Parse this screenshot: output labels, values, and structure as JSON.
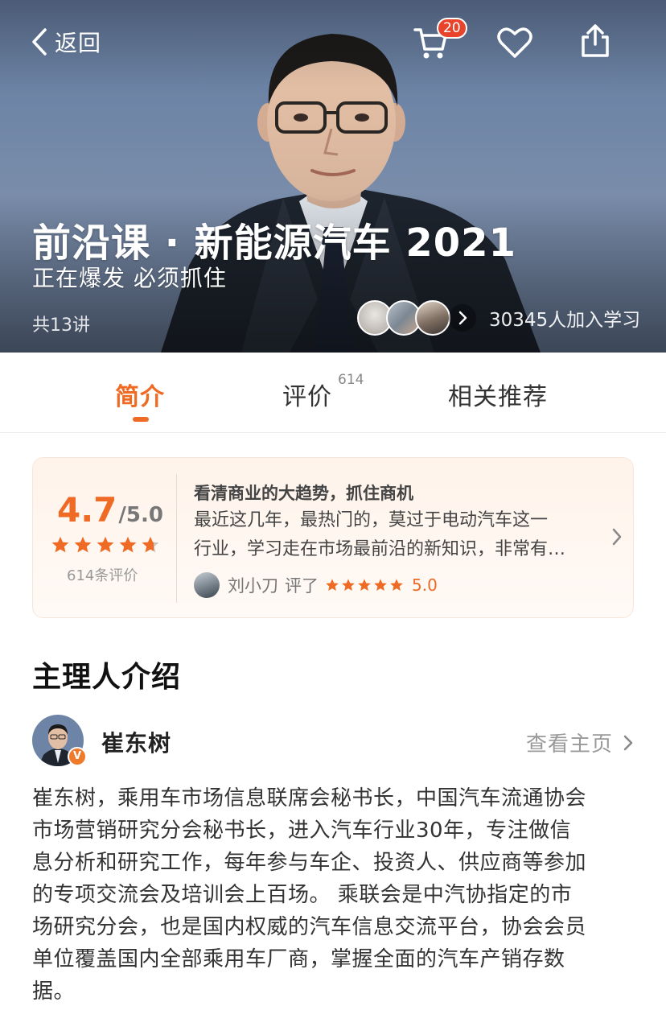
{
  "nav": {
    "back_label": "返回",
    "cart_badge": "20"
  },
  "course": {
    "title": "前沿课 · 新能源汽车 2021",
    "subtitle": "正在爆发 必须抓住",
    "lesson_count": "共13讲",
    "learners_text": "30345人加入学习"
  },
  "tabs": {
    "intro": "简介",
    "review": "评价",
    "review_count": "614",
    "related": "相关推荐",
    "active": "intro"
  },
  "rating": {
    "score": "4.7",
    "total": "/5.0",
    "stars": 4.7,
    "review_count": "614条评价",
    "review_title": "看清商业的大趋势，抓住商机",
    "review_body_lines": [
      "最近这几年，最热门的，莫过于电动汽车这一",
      "行业，学习走在市场最前沿的新知识，非常有…"
    ],
    "reviewer_name": "刘小刀",
    "reviewer_verb": "评了",
    "reviewer_stars": 5,
    "reviewer_score": "5.0"
  },
  "host_section": {
    "title": "主理人介绍",
    "name": "崔东树",
    "link_label": "查看主页",
    "badge": "V",
    "bio_lines": [
      "崔东树，乘用车市场信息联席会秘书长，中国汽车流通协会",
      "市场营销研究分会秘书长，进入汽车行业30年，专注做信",
      "息分析和研究工作，每年参与车企、投资人、供应商等参加",
      "的专项交流会及培训会上百场。 乘联会是中汽协指定的市",
      "场研究分会，也是国内权威的汽车信息交流平台，协会会员",
      "单位覆盖国内全部乘用车厂商，掌握全面的汽车产销存数",
      "据。"
    ]
  },
  "colors": {
    "accent": "#ef6a24",
    "badge_red": "#e8442c",
    "star": "#ef6a24"
  },
  "icons": {
    "back": "chevron-left-icon",
    "cart": "cart-icon",
    "favorite": "heart-icon",
    "share": "share-icon"
  }
}
